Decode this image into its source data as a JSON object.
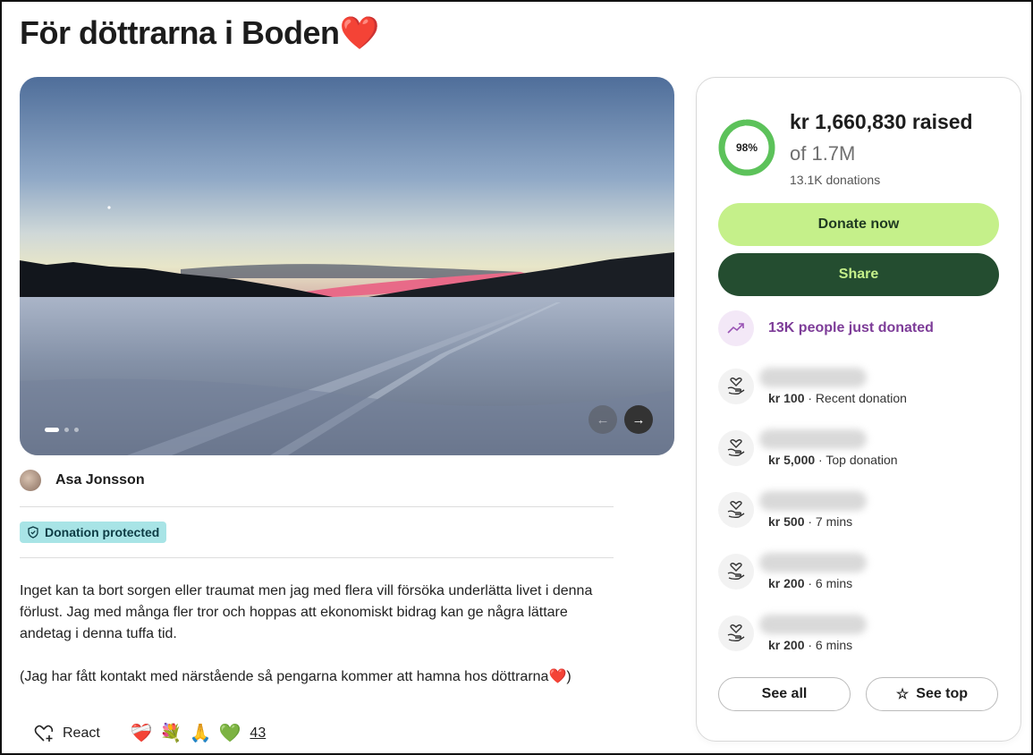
{
  "page": {
    "title": "För döttrarna i Boden❤️"
  },
  "carousel": {
    "slide_count": 3,
    "active_slide": 1,
    "prev_icon": "←",
    "next_icon": "→"
  },
  "organizer": {
    "name": "Asa Jonsson"
  },
  "badge": {
    "label": "Donation protected"
  },
  "story": {
    "paragraphs": [
      "Inget kan ta bort sorgen eller traumat men jag med flera vill försöka underlätta livet i denna förlust. Jag med många fler tror och hoppas att ekonomiskt bidrag kan ge några lättare andetag i denna tuffa tid.",
      "(Jag har fått kontakt med närstående så pengarna kommer att hamna hos döttrarna❤️)"
    ]
  },
  "reactions": {
    "react_label": "React",
    "emojis": [
      "❤️‍🩹",
      "💐",
      "🙏",
      "💚"
    ],
    "count": "43"
  },
  "fundraiser": {
    "percent_label": "98%",
    "progress_fraction": 0.98,
    "raised": "kr 1,660,830 raised",
    "goal": "of 1.7M",
    "donation_count": "13.1K donations",
    "donate_label": "Donate now",
    "share_label": "Share",
    "trend_text": "13K people just donated",
    "donors": [
      {
        "amount": "kr 100",
        "note": " · Recent donation"
      },
      {
        "amount": "kr 5,000",
        "note": " · Top donation"
      },
      {
        "amount": "kr 500",
        "note": " · 7 mins"
      },
      {
        "amount": "kr 200",
        "note": " · 6 mins"
      },
      {
        "amount": "kr 200",
        "note": " · 6 mins"
      }
    ],
    "see_all_label": "See all",
    "see_top_label": "See top",
    "see_top_icon": "☆"
  },
  "colors": {
    "donate_bg": "#c5f08a",
    "share_bg": "#244d30",
    "progress": "#5cc25a",
    "trend_text": "#7d3c98",
    "badge_bg": "#a8e4e6"
  }
}
